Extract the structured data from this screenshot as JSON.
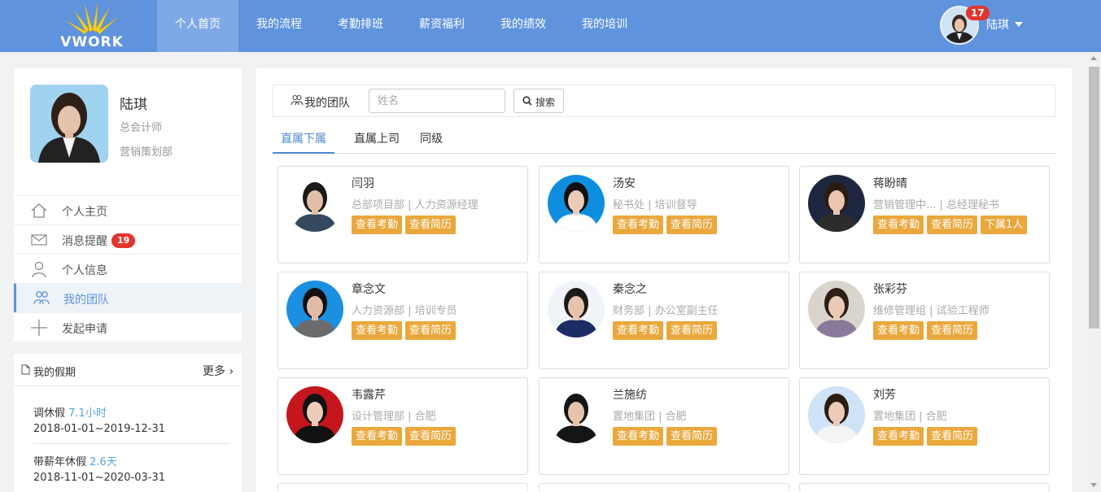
{
  "app": {
    "logo_text": "VWORK"
  },
  "nav": {
    "items": [
      {
        "label": "个人首页",
        "active": true
      },
      {
        "label": "我的流程"
      },
      {
        "label": "考勤排班"
      },
      {
        "label": "薪资福利"
      },
      {
        "label": "我的绩效"
      },
      {
        "label": "我的培训"
      }
    ]
  },
  "user": {
    "name": "陆琪",
    "notification_count": "17"
  },
  "profile": {
    "name": "陆琪",
    "title": "总会计师",
    "department": "营销策划部"
  },
  "menu": {
    "items": [
      {
        "label": "个人主页",
        "icon": "home-icon"
      },
      {
        "label": "消息提醒",
        "icon": "mail-icon",
        "badge": "19"
      },
      {
        "label": "个人信息",
        "icon": "user-icon"
      },
      {
        "label": "我的团队",
        "icon": "team-icon",
        "active": true
      },
      {
        "label": "发起申请",
        "icon": "plus-icon"
      }
    ]
  },
  "holidays": {
    "title": "我的假期",
    "more": "更多",
    "items": [
      {
        "name": "调休假",
        "value": "7.1小时",
        "range": "2018-01-01~2019-12-31"
      },
      {
        "name": "带薪年休假",
        "value": "2.6天",
        "range": "2018-11-01~2020-03-31"
      }
    ]
  },
  "team": {
    "title": "我的团队",
    "search_placeholder": "姓名",
    "search_label": "搜索",
    "tabs": [
      "直属下属",
      "直属上司",
      "同级"
    ],
    "members": [
      {
        "name": "闫羽",
        "dept": "总部项目部 | 人力资源经理",
        "buttons": [
          "查看考勤",
          "查看简历"
        ]
      },
      {
        "name": "汤安",
        "dept": "秘书处 | 培训督导",
        "buttons": [
          "查看考勤",
          "查看简历"
        ]
      },
      {
        "name": "蒋盼晴",
        "dept": "营销管理中... | 总经理秘书",
        "buttons": [
          "查看考勤",
          "查看简历",
          "下属1人"
        ]
      },
      {
        "name": "章念文",
        "dept": "人力资源部 | 培训专员",
        "buttons": [
          "查看考勤",
          "查看简历"
        ]
      },
      {
        "name": "秦念之",
        "dept": "财务部 | 办公室副主任",
        "buttons": [
          "查看考勤",
          "查看简历"
        ]
      },
      {
        "name": "张彩芬",
        "dept": "维修管理组 | 试验工程师",
        "buttons": [
          "查看考勤",
          "查看简历"
        ]
      },
      {
        "name": "韦露芹",
        "dept": "设计管理部 | 合肥",
        "buttons": [
          "查看考勤",
          "查看简历"
        ]
      },
      {
        "name": "兰施纺",
        "dept": "置地集团 | 合肥",
        "buttons": [
          "查看考勤",
          "查看简历"
        ]
      },
      {
        "name": "刘芳",
        "dept": "置地集团 | 合肥",
        "buttons": [
          "查看考勤",
          "查看简历"
        ]
      }
    ]
  },
  "colors": {
    "nav_bg": "#5f93de",
    "accent": "#4d8acf",
    "button": "#eaa83c",
    "badge": "#e2352e"
  }
}
